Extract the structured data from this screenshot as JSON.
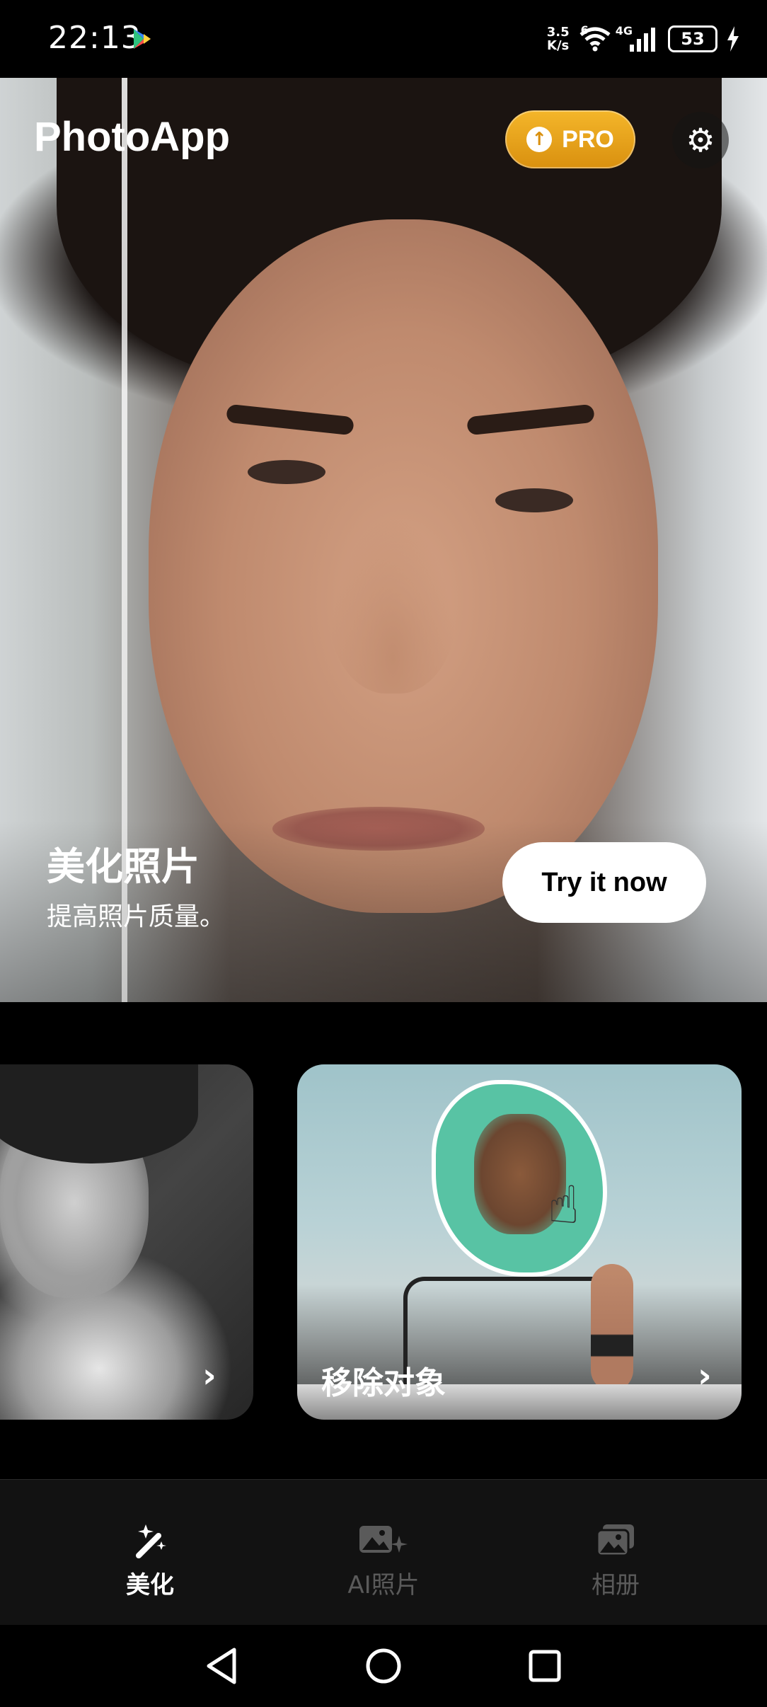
{
  "status_bar": {
    "time": "22:13",
    "net_speed_value": "3.5",
    "net_speed_unit": "K/s",
    "wifi_label": "6",
    "cell_label": "4G",
    "battery": "53"
  },
  "header": {
    "app_title": "PhotoApp",
    "pro_label": "PRO"
  },
  "hero": {
    "heading": "美化照片",
    "subheading": "提高照片质量。",
    "cta_label": "Try it now"
  },
  "cards": [
    {
      "label": ""
    },
    {
      "label": "移除对象"
    }
  ],
  "bottom_nav": {
    "items": [
      {
        "label": "美化",
        "icon": "magic-wand-icon",
        "active": true
      },
      {
        "label": "AI照片",
        "icon": "ai-image-icon",
        "active": false
      },
      {
        "label": "相册",
        "icon": "gallery-icon",
        "active": false
      }
    ]
  },
  "colors": {
    "accent": "#f4b62a",
    "background": "#000000",
    "nav_active": "#ffffff",
    "nav_inactive": "#5a5a5a"
  }
}
